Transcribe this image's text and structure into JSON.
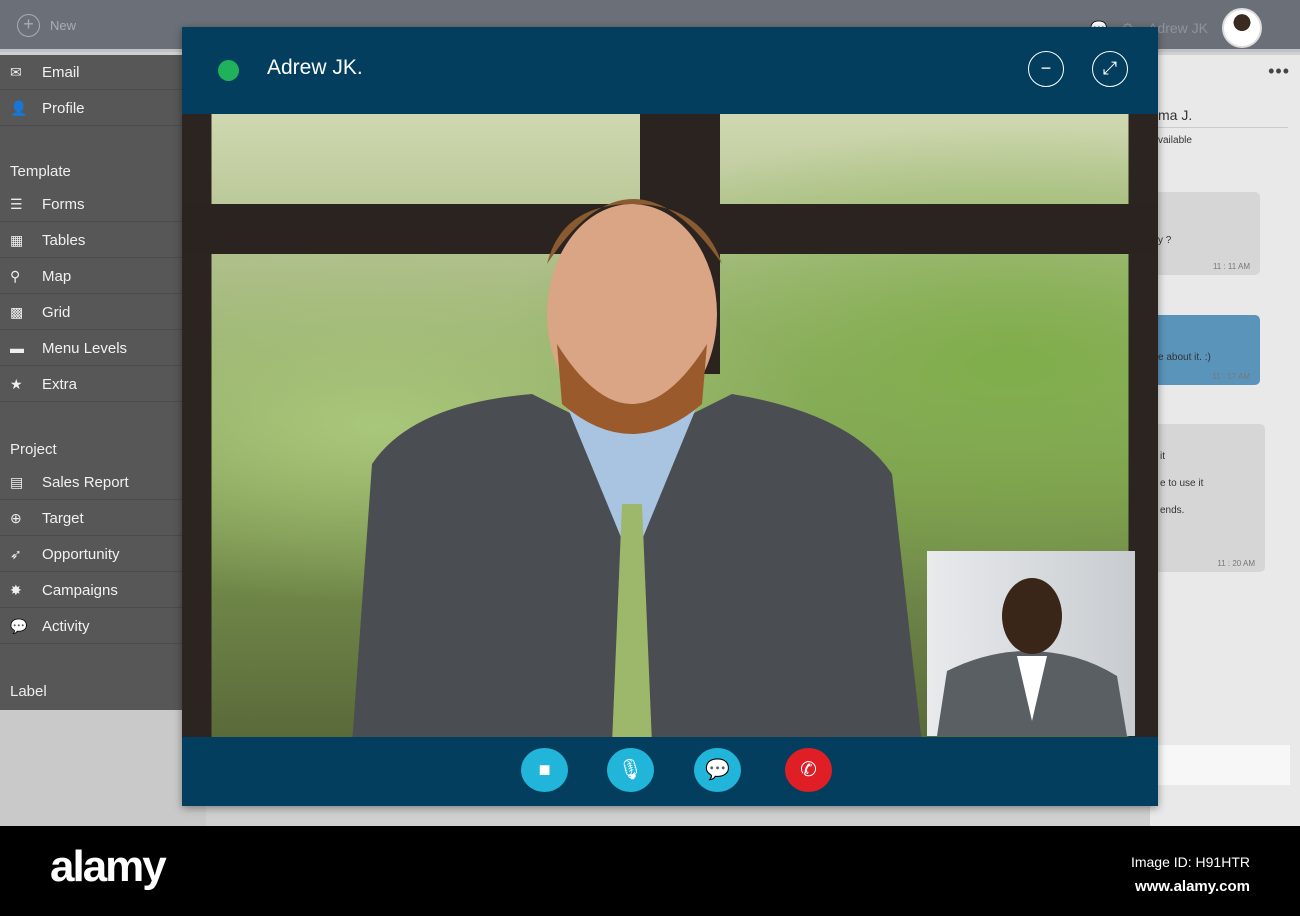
{
  "topbar": {
    "new_label": "New",
    "user_name": "Adrew JK"
  },
  "sidebar": {
    "items": [
      {
        "label": "Email",
        "icon": "✉"
      },
      {
        "label": "Profile",
        "icon": "👤"
      }
    ],
    "template_title": "Template",
    "template_items": [
      {
        "label": "Forms",
        "icon": "☰"
      },
      {
        "label": "Tables",
        "icon": "▦"
      },
      {
        "label": "Map",
        "icon": "⚲"
      },
      {
        "label": "Grid",
        "icon": "▩"
      },
      {
        "label": "Menu Levels",
        "icon": "▬"
      },
      {
        "label": "Extra",
        "icon": "★"
      }
    ],
    "project_title": "Project",
    "project_items": [
      {
        "label": "Sales Report",
        "icon": "▤"
      },
      {
        "label": "Target",
        "icon": "⊕"
      },
      {
        "label": "Opportunity",
        "icon": "➶"
      },
      {
        "label": "Campaigns",
        "icon": "✸"
      },
      {
        "label": "Activity",
        "icon": "💬"
      }
    ],
    "label_title": "Label"
  },
  "chat": {
    "name": "ma J.",
    "status": "vailable",
    "messages": [
      {
        "text": "y ?",
        "time": "11 : 11 AM"
      },
      {
        "text": "e about it. :)",
        "time": "11 : 17 AM"
      },
      {
        "lines": [
          "it",
          "e to use it",
          "ends."
        ],
        "time": "11 : 20 AM"
      }
    ]
  },
  "call": {
    "contact_name": "Adrew JK.",
    "status_color": "#1fb25a",
    "accent": "#20b5d9",
    "end_color": "#e01e26"
  },
  "footer": {
    "logo": "alamy",
    "image_id": "Image ID: H91HTR",
    "url": "www.alamy.com"
  }
}
